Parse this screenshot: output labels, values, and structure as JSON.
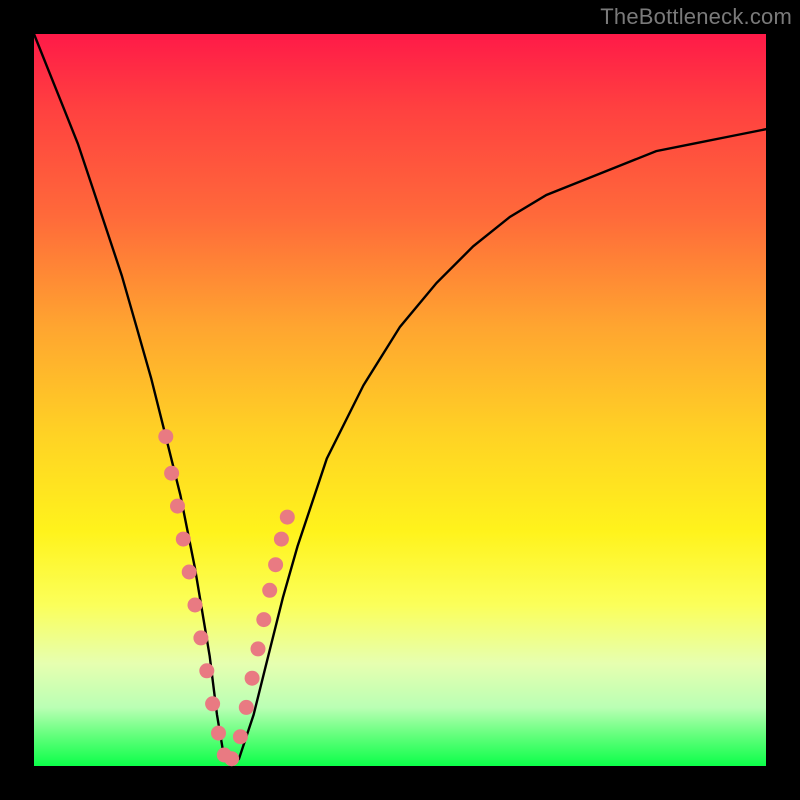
{
  "watermark": "TheBottleneck.com",
  "colors": {
    "frame": "#000000",
    "curve": "#000000",
    "markers": "#e97a82",
    "gradient_top": "#ff1a48",
    "gradient_bottom": "#0cff49"
  },
  "chart_data": {
    "type": "line",
    "title": "",
    "xlabel": "",
    "ylabel": "",
    "xlim": [
      0,
      100
    ],
    "ylim": [
      0,
      100
    ],
    "grid": false,
    "legend": false,
    "note": "V-shaped bottleneck curve. x is normalized horizontal position (0–100). y is normalized height (0 = bottom/green/good, 100 = top/red/bad). Values estimated from pixel positions; no axis ticks are shown in the image.",
    "series": [
      {
        "name": "bottleneck-curve",
        "x": [
          0,
          2,
          4,
          6,
          8,
          10,
          12,
          14,
          16,
          18,
          20,
          22,
          24,
          25,
          26,
          27,
          28,
          30,
          32,
          34,
          36,
          40,
          45,
          50,
          55,
          60,
          65,
          70,
          75,
          80,
          85,
          90,
          95,
          100
        ],
        "y": [
          100,
          95,
          90,
          85,
          79,
          73,
          67,
          60,
          53,
          45,
          37,
          27,
          15,
          7,
          1,
          0,
          1,
          7,
          15,
          23,
          30,
          42,
          52,
          60,
          66,
          71,
          75,
          78,
          80,
          82,
          84,
          85,
          86,
          87
        ]
      }
    ],
    "markers": {
      "name": "highlighted-points",
      "note": "Salmon dotted markers clustered near the valley along both arms of the V.",
      "x": [
        18.0,
        18.8,
        19.6,
        20.4,
        21.2,
        22.0,
        22.8,
        23.6,
        24.4,
        25.2,
        26.0,
        27.0,
        28.2,
        29.0,
        29.8,
        30.6,
        31.4,
        32.2,
        33.0,
        33.8,
        34.6
      ],
      "y": [
        45.0,
        40.0,
        35.5,
        31.0,
        26.5,
        22.0,
        17.5,
        13.0,
        8.5,
        4.5,
        1.5,
        1.0,
        4.0,
        8.0,
        12.0,
        16.0,
        20.0,
        24.0,
        27.5,
        31.0,
        34.0
      ]
    }
  }
}
